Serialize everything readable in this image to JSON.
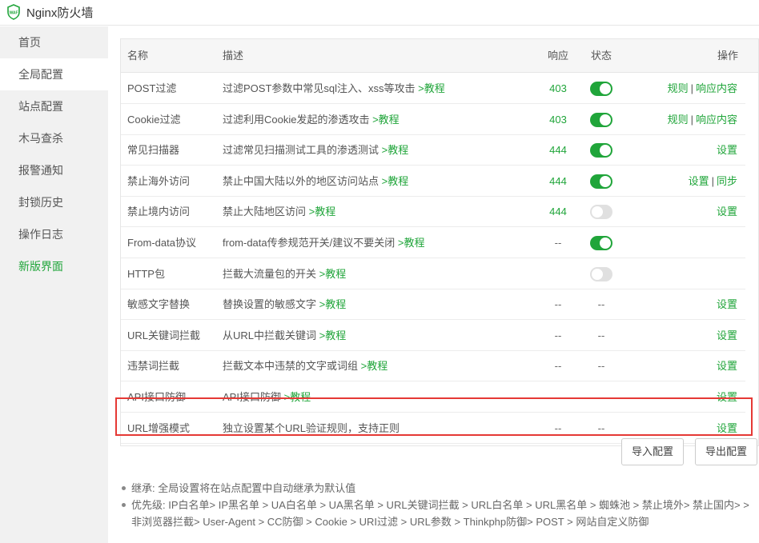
{
  "app": {
    "title": "Nginx防火墙",
    "logo_text": "WAF"
  },
  "sidebar": {
    "items": [
      {
        "label": "首页"
      },
      {
        "label": "全局配置"
      },
      {
        "label": "站点配置"
      },
      {
        "label": "木马查杀"
      },
      {
        "label": "报警通知"
      },
      {
        "label": "封锁历史"
      },
      {
        "label": "操作日志"
      },
      {
        "label": "新版界面"
      }
    ]
  },
  "table": {
    "headers": {
      "name": "名称",
      "desc": "描述",
      "resp": "响应",
      "state": "状态",
      "action": "操作"
    },
    "tutorial_label": ">教程",
    "rows": [
      {
        "name": "POST过滤",
        "desc": "过滤POST参数中常见sql注入、xss等攻击 ",
        "resp": "403",
        "state": "on",
        "actions": [
          "规则",
          "响应内容"
        ]
      },
      {
        "name": "Cookie过滤",
        "desc": "过滤利用Cookie发起的渗透攻击 ",
        "resp": "403",
        "state": "on",
        "actions": [
          "规则",
          "响应内容"
        ]
      },
      {
        "name": "常见扫描器",
        "desc": "过滤常见扫描测试工具的渗透测试 ",
        "resp": "444",
        "state": "on",
        "actions": [
          "设置"
        ]
      },
      {
        "name": "禁止海外访问",
        "desc": "禁止中国大陆以外的地区访问站点 ",
        "resp": "444",
        "state": "on",
        "actions": [
          "设置",
          "同步"
        ]
      },
      {
        "name": "禁止境内访问",
        "desc": "禁止大陆地区访问 ",
        "resp": "444",
        "state": "off",
        "actions": [
          "设置"
        ]
      },
      {
        "name": "From-data协议",
        "desc": "from-data传参规范开关/建议不要关闭 ",
        "resp": "--",
        "state": "on",
        "actions": []
      },
      {
        "name": "HTTP包",
        "desc": "拦截大流量包的开关 ",
        "resp": "",
        "state": "off",
        "actions": []
      },
      {
        "name": "敏感文字替换",
        "desc": "替换设置的敏感文字 ",
        "resp": "--",
        "state": "--",
        "actions": [
          "设置"
        ]
      },
      {
        "name": "URL关键词拦截",
        "desc": "从URL中拦截关键词 ",
        "resp": "--",
        "state": "--",
        "actions": [
          "设置"
        ]
      },
      {
        "name": "违禁词拦截",
        "desc": "拦截文本中违禁的文字或词组 ",
        "resp": "--",
        "state": "--",
        "actions": [
          "设置"
        ]
      },
      {
        "name": "API接口防御",
        "desc": "API接口防御 ",
        "resp": "--",
        "state": "--",
        "actions": [
          "设置"
        ]
      },
      {
        "name": "URL增强模式",
        "desc": "独立设置某个URL验证规则，支持正则",
        "resp": "--",
        "state": "--",
        "actions": [
          "设置"
        ],
        "no_tutorial": true
      }
    ]
  },
  "buttons": {
    "import": "导入配置",
    "export": "导出配置"
  },
  "notes": [
    "继承: 全局设置将在站点配置中自动继承为默认值",
    "优先级: IP白名单> IP黑名单 > UA白名单 > UA黑名单 > URL关键词拦截 > URL白名单 > URL黑名单 > 蜘蛛池 > 禁止境外> 禁止国内> > 非浏览器拦截> User-Agent > CC防御 > Cookie > URI过滤 > URL参数 > Thinkphp防御> POST > 网站自定义防御"
  ],
  "colors": {
    "accent": "#20a53a",
    "highlight": "#e53935"
  }
}
